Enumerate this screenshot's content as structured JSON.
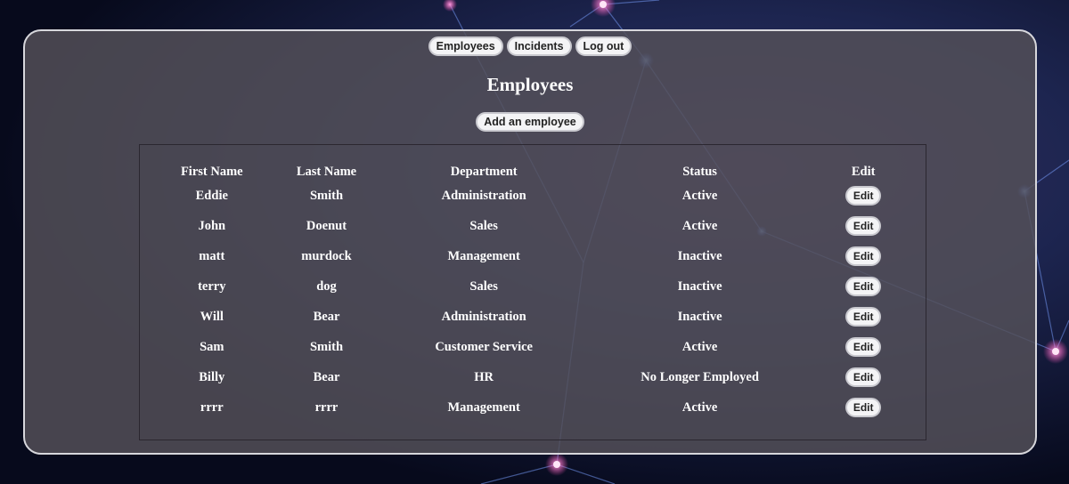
{
  "nav": {
    "employees_label": "Employees",
    "incidents_label": "Incidents",
    "logout_label": "Log out"
  },
  "page": {
    "title": "Employees",
    "add_label": "Add an employee"
  },
  "table": {
    "headers": [
      "First Name",
      "Last Name",
      "Department",
      "Status",
      "Edit"
    ],
    "edit_label": "Edit",
    "rows": [
      {
        "first": "Eddie",
        "last": "Smith",
        "department": "Administration",
        "status": "Active"
      },
      {
        "first": "John",
        "last": "Doenut",
        "department": "Sales",
        "status": "Active"
      },
      {
        "first": "matt",
        "last": "murdock",
        "department": "Management",
        "status": "Inactive"
      },
      {
        "first": "terry",
        "last": "dog",
        "department": "Sales",
        "status": "Inactive"
      },
      {
        "first": "Will",
        "last": "Bear",
        "department": "Administration",
        "status": "Inactive"
      },
      {
        "first": "Sam",
        "last": "Smith",
        "department": "Customer Service",
        "status": "Active"
      },
      {
        "first": "Billy",
        "last": "Bear",
        "department": "HR",
        "status": "No Longer Employed"
      },
      {
        "first": "rrrr",
        "last": "rrrr",
        "department": "Management",
        "status": "Active"
      }
    ]
  },
  "colors": {
    "panel": "#545058",
    "button_bg": "#f4f4f6",
    "text": "#ffffff",
    "background": "#0b0f24"
  }
}
